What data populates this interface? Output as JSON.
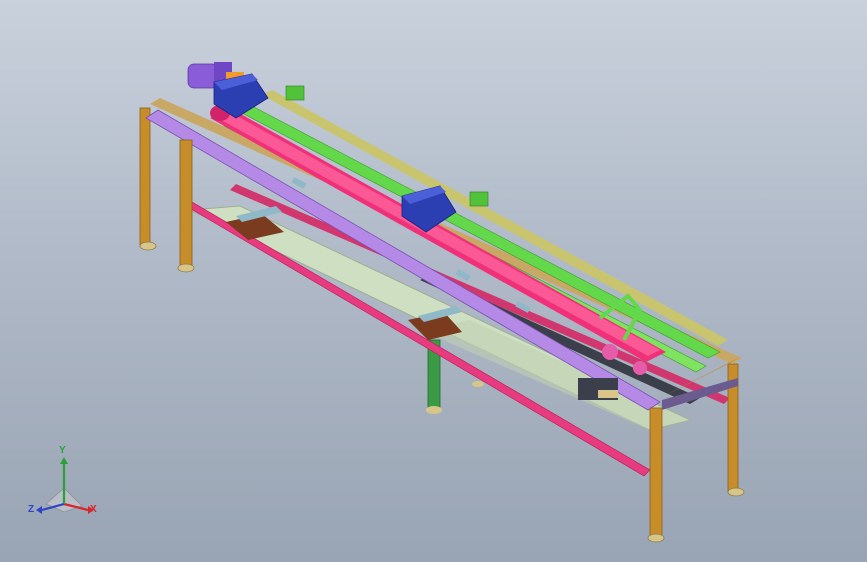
{
  "viewport": {
    "background_top": "#c9d1dc",
    "background_bottom": "#99a4b4"
  },
  "model": {
    "colors": {
      "legs": "#c78d2a",
      "leg_feet": "#d8c58a",
      "top_rail_front": "#b48ae6",
      "lower_rail_front": "#e83a7e",
      "main_roller": "#f0317a",
      "green_rail": "#63d84a",
      "motor": "#8a5cd8",
      "blue_housing": "#2c3fb2",
      "tray": "#cfe0c2",
      "green_post": "#3a9a45",
      "pink_fittings": "#e75ca8"
    },
    "parts": [
      "left-front-leg",
      "left-back-leg",
      "right-front-leg",
      "right-back-leg",
      "middle-support-post",
      "top-rail-front",
      "top-rail-back",
      "lower-rail-front",
      "lower-rail-back",
      "main-roller",
      "green-guide-rail",
      "yellow-guide-rail",
      "drive-motor",
      "blue-gear-housing-left",
      "blue-gear-housing-mid",
      "bottom-tray"
    ]
  },
  "triad": {
    "x_label": "X",
    "y_label": "Y",
    "z_label": "Z",
    "x_color": "#d8262b",
    "y_color": "#2aa136",
    "z_color": "#2c44c8"
  }
}
